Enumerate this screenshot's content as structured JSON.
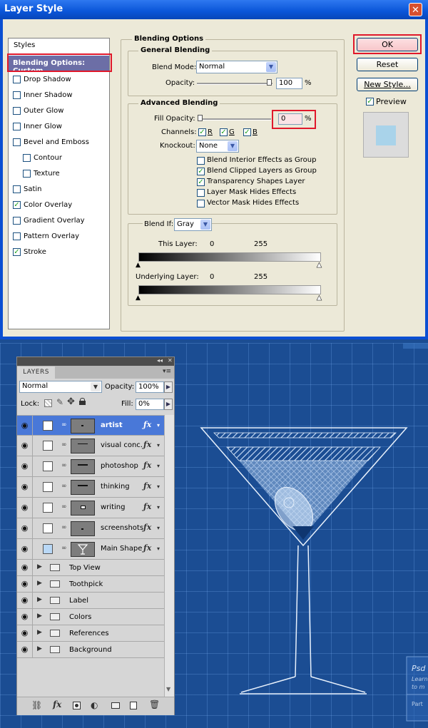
{
  "dialog": {
    "title": "Layer Style",
    "close_glyph": "✕",
    "styles_header": "Styles",
    "style_items": [
      {
        "label": "Blending Options: Custom",
        "checked": null,
        "selected": true
      },
      {
        "label": "Drop Shadow",
        "checked": false
      },
      {
        "label": "Inner Shadow",
        "checked": false
      },
      {
        "label": "Outer Glow",
        "checked": false
      },
      {
        "label": "Inner Glow",
        "checked": false
      },
      {
        "label": "Bevel and Emboss",
        "checked": false
      },
      {
        "label": "Contour",
        "checked": false,
        "indent": true
      },
      {
        "label": "Texture",
        "checked": false,
        "indent": true
      },
      {
        "label": "Satin",
        "checked": false
      },
      {
        "label": "Color Overlay",
        "checked": true
      },
      {
        "label": "Gradient Overlay",
        "checked": false
      },
      {
        "label": "Pattern Overlay",
        "checked": false
      },
      {
        "label": "Stroke",
        "checked": true
      }
    ],
    "blending_options_title": "Blending Options",
    "general_blending_title": "General Blending",
    "blend_mode_label": "Blend Mode:",
    "blend_mode_value": "Normal",
    "opacity_label": "Opacity:",
    "opacity_value": "100",
    "percent": "%",
    "advanced_blending_title": "Advanced Blending",
    "fill_opacity_label": "Fill Opacity:",
    "fill_opacity_value": "0",
    "channels_label": "Channels:",
    "channels": [
      {
        "label": "R",
        "checked": true
      },
      {
        "label": "G",
        "checked": true
      },
      {
        "label": "B",
        "checked": true
      }
    ],
    "knockout_label": "Knockout:",
    "knockout_value": "None",
    "advanced_options": [
      {
        "label": "Blend Interior Effects as Group",
        "checked": false
      },
      {
        "label": "Blend Clipped Layers as Group",
        "checked": true
      },
      {
        "label": "Transparency Shapes Layer",
        "checked": true
      },
      {
        "label": "Layer Mask Hides Effects",
        "checked": false
      },
      {
        "label": "Vector Mask Hides Effects",
        "checked": false
      }
    ],
    "blend_if_label": "Blend If:",
    "blend_if_value": "Gray",
    "this_layer_label": "This Layer:",
    "this_layer_min": "0",
    "this_layer_max": "255",
    "underlying_layer_label": "Underlying Layer:",
    "underlying_layer_min": "0",
    "underlying_layer_max": "255",
    "ok_label": "OK",
    "reset_label": "Reset",
    "new_style_label": "New Style...",
    "preview_label": "Preview",
    "preview_checked": true
  },
  "layers_panel": {
    "tab_label": "LAYERS",
    "collapse_glyph": "◂◂",
    "close_glyph": "✕",
    "menu_glyph": "▾≡",
    "blend_mode": "Normal",
    "opacity_label": "Opacity:",
    "opacity_value": "100%",
    "lock_label": "Lock:",
    "fill_label": "Fill:",
    "fill_value": "0%",
    "fx_label": "fx",
    "layers": [
      {
        "name": "artist",
        "selected": true,
        "swatch": "#ffffff"
      },
      {
        "name": "visual conc...",
        "selected": false,
        "swatch": "#ffffff"
      },
      {
        "name": "photoshop",
        "selected": false,
        "swatch": "#ffffff"
      },
      {
        "name": "thinking",
        "selected": false,
        "swatch": "#ffffff"
      },
      {
        "name": "writing",
        "selected": false,
        "swatch": "#ffffff"
      },
      {
        "name": "screenshots",
        "selected": false,
        "swatch": "#ffffff"
      },
      {
        "name": "Main Shape",
        "selected": false,
        "swatch": "#b9d8f6"
      }
    ],
    "groups": [
      "Top View",
      "Toothpick",
      "Label",
      "Colors",
      "References",
      "Background"
    ]
  },
  "canvas": {
    "watermark_title": "Psd",
    "watermark_line1": "Learn",
    "watermark_line2": "to m",
    "watermark_part": "Part"
  },
  "colors": {
    "accent_red": "#e0182b",
    "xp_blue": "#0b4fd2",
    "selection_blue": "#4978d8",
    "blueprint": "#1b4d93"
  }
}
